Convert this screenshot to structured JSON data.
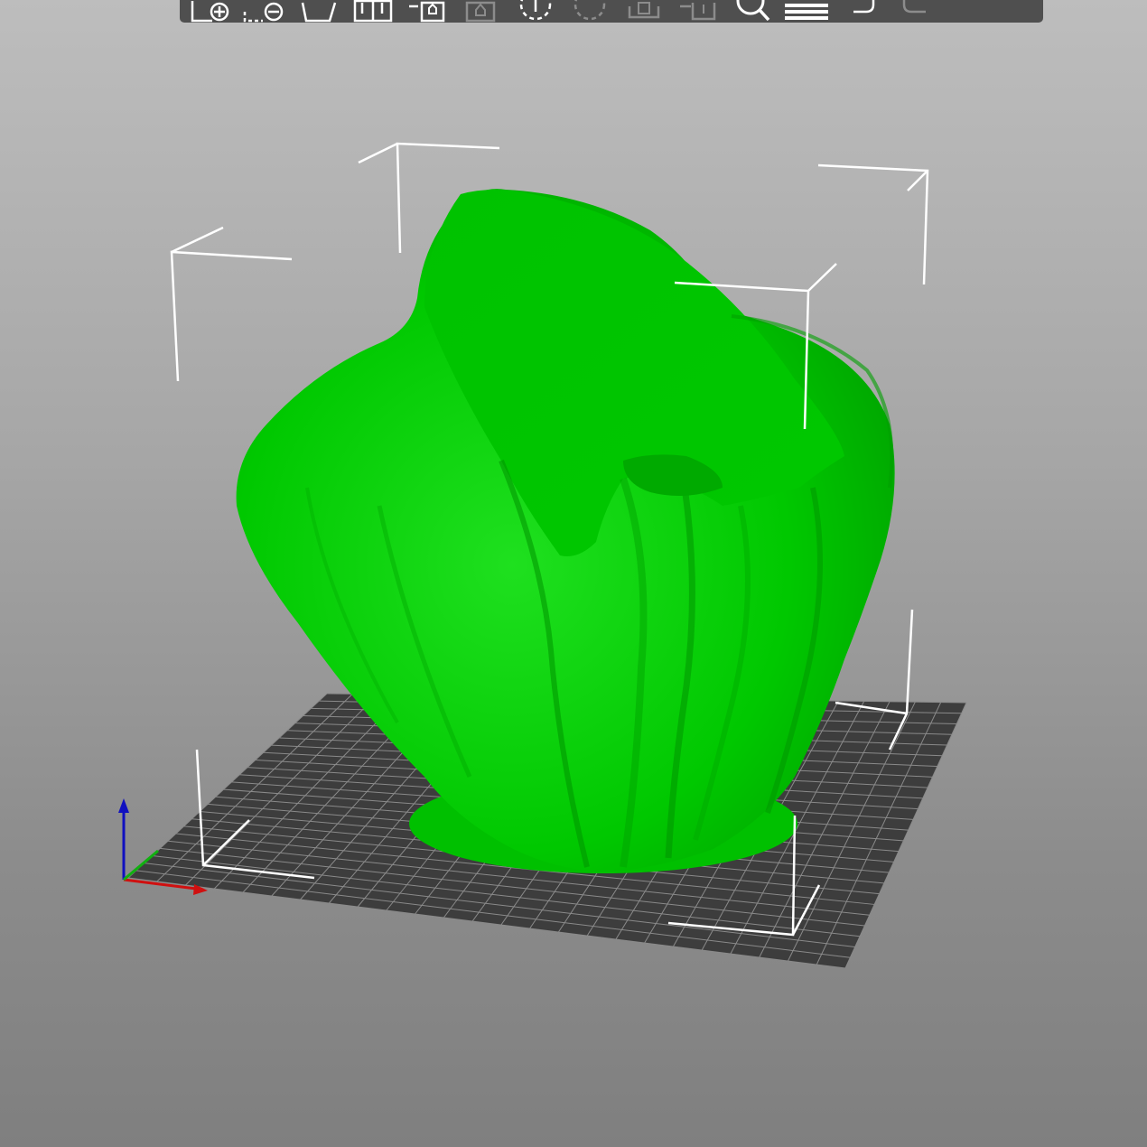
{
  "app": {
    "view": "3d-plater"
  },
  "toolbar": {
    "buttons": [
      {
        "name": "add-icon",
        "enabled": true
      },
      {
        "name": "delete-icon",
        "enabled": true
      },
      {
        "name": "delete-all-icon",
        "enabled": true
      },
      {
        "name": "arrange-icon",
        "enabled": true
      },
      {
        "name": "copy-icon",
        "enabled": true
      },
      {
        "name": "paste-icon",
        "enabled": false
      },
      {
        "name": "add-instance-icon",
        "enabled": true
      },
      {
        "name": "remove-instance-icon",
        "enabled": false
      },
      {
        "name": "split-objects-icon",
        "enabled": false
      },
      {
        "name": "split-parts-icon",
        "enabled": false
      },
      {
        "name": "search-icon",
        "enabled": true
      },
      {
        "name": "layers-editing-icon",
        "enabled": true
      },
      {
        "name": "undo-icon",
        "enabled": true
      },
      {
        "name": "redo-icon",
        "enabled": false
      }
    ]
  },
  "scene": {
    "model_color": "#00c800",
    "model_highlight": "#1fe01f",
    "bed_color": "#3d3d3d",
    "bed_grid_color": "#8a8a8a",
    "bbox_color": "#ffffff",
    "axis_x_color": "#d01010",
    "axis_y_color": "#10b010",
    "axis_z_color": "#1010c0"
  }
}
